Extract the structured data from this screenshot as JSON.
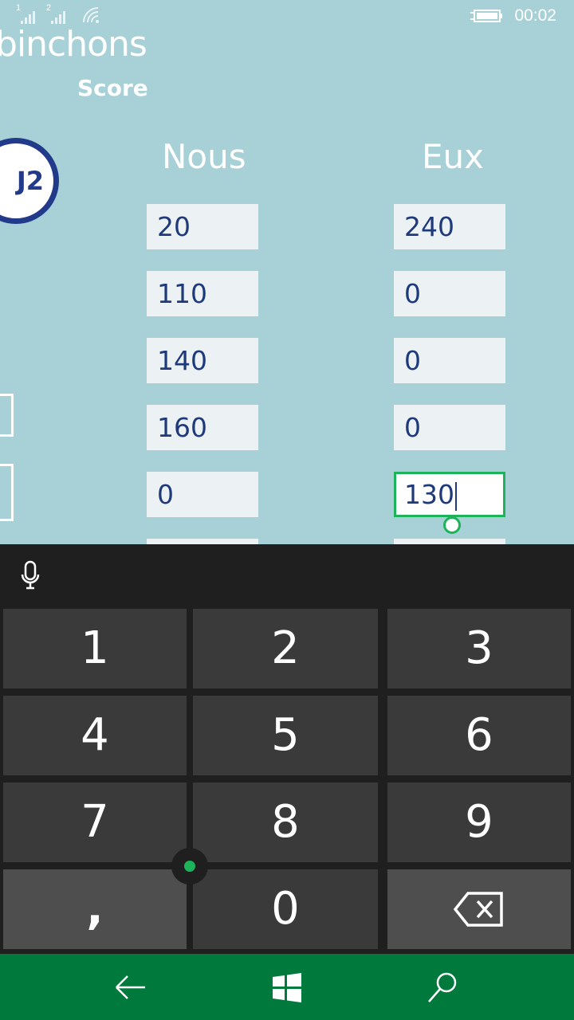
{
  "status": {
    "sim1": "1",
    "sim2": "2",
    "time": "00:02"
  },
  "app": {
    "title": "binchons",
    "subtitle": "Score",
    "badge": "J2"
  },
  "columns": {
    "left": "Nous",
    "right": "Eux"
  },
  "rows": [
    {
      "nous": "20",
      "eux": "240"
    },
    {
      "nous": "110",
      "eux": "0"
    },
    {
      "nous": "140",
      "eux": "0"
    },
    {
      "nous": "160",
      "eux": "0"
    },
    {
      "nous": "0",
      "eux": "130"
    }
  ],
  "keyboard": {
    "keys": [
      "1",
      "2",
      "3",
      "4",
      "5",
      "6",
      "7",
      "8",
      "9",
      ",",
      "0"
    ],
    "icons": [
      "microphone-icon",
      "backspace-icon"
    ]
  },
  "nav": {
    "icons": [
      "back-arrow-icon",
      "windows-start-icon",
      "search-icon"
    ]
  },
  "colors": {
    "background": "#a7d0d7",
    "accent": "#1db35a",
    "navbar": "#007a3c",
    "field_text": "#1f3a7a"
  }
}
